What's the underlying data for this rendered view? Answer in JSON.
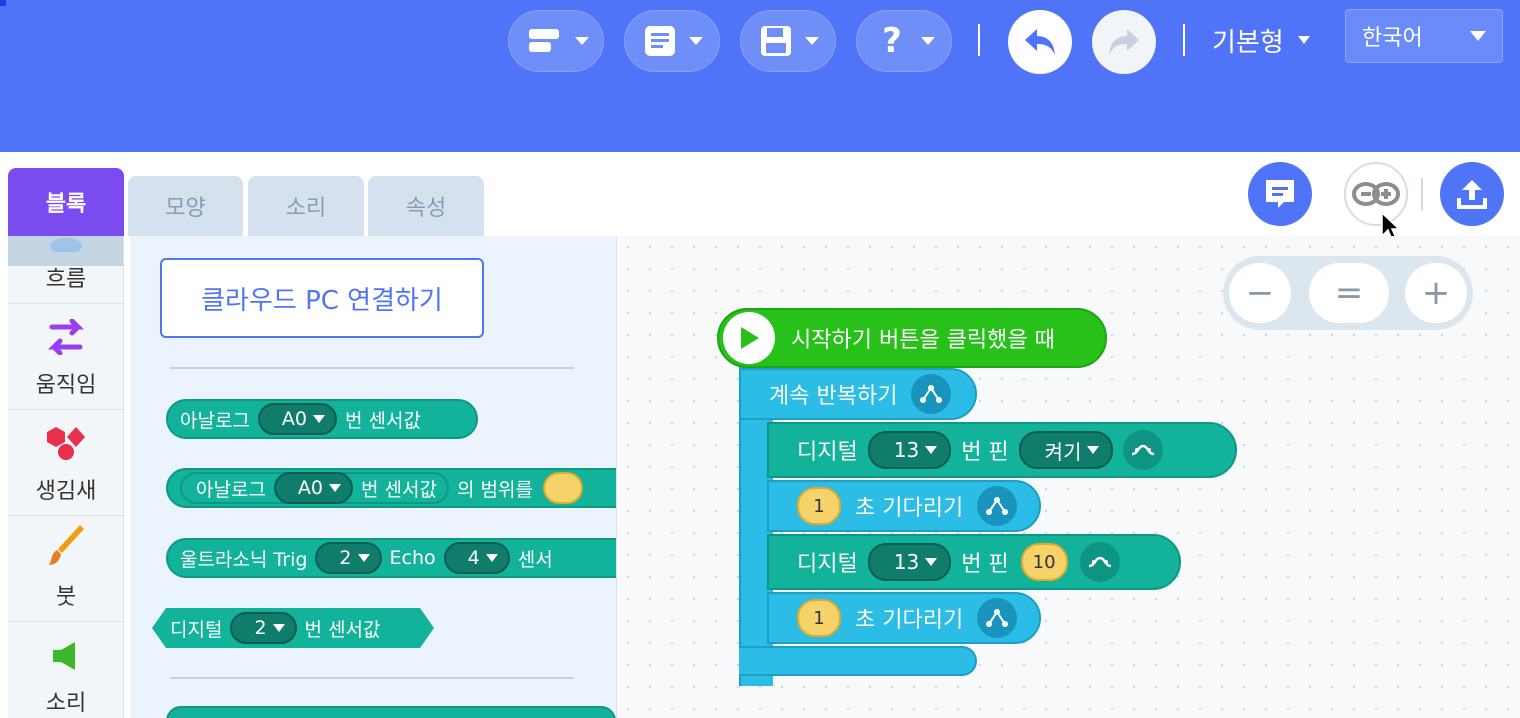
{
  "colors": {
    "header": "#4f74f7",
    "tab_active": "#7a4cf0",
    "hardware_block": "#12b29b",
    "flow_block": "#2cbde6",
    "start_block": "#27c11a",
    "number_oval": "#f6d26b"
  },
  "header": {
    "menu_buttons": [
      {
        "icon": "blocks-icon"
      },
      {
        "icon": "document-icon"
      },
      {
        "icon": "save-icon"
      },
      {
        "icon": "help-icon"
      }
    ],
    "undo_icon": "undo-icon",
    "redo_icon": "redo-icon",
    "mode_label": "기본형",
    "language": "한국어"
  },
  "tabs": [
    {
      "label": "블록",
      "active": true
    },
    {
      "label": "모양",
      "active": false
    },
    {
      "label": "소리",
      "active": false
    },
    {
      "label": "속성",
      "active": false
    }
  ],
  "side_buttons": [
    "chat-icon",
    "arduino-icon",
    "upload-icon"
  ],
  "categories": [
    {
      "label": "흐름",
      "icon": "flow-icon"
    },
    {
      "label": "움직임",
      "icon": "move-arrows-icon"
    },
    {
      "label": "생김새",
      "icon": "shapes-icon"
    },
    {
      "label": "붓",
      "icon": "brush-icon"
    },
    {
      "label": "소리",
      "icon": "speaker-icon"
    }
  ],
  "palette": {
    "cloud_button": "클라우드 PC 연결하기",
    "blocks": [
      {
        "pre": "아날로그",
        "drop": "A0",
        "post": "번 센서값"
      },
      {
        "pre": "아날로그",
        "drop": "A0",
        "post": "번 센서값",
        "tail": "의 범위를"
      },
      {
        "pre": "울트라소닉 Trig",
        "drop": "2",
        "mid": "Echo",
        "drop2": "4",
        "tail": "센서"
      },
      {
        "pre": "디지털",
        "drop": "2",
        "post": "번 센서값"
      }
    ]
  },
  "zoom": {
    "minus": "−",
    "reset": "=",
    "plus": "+"
  },
  "script": {
    "start": "시작하기 버튼을 클릭했을 때",
    "loop": "계속 반복하기",
    "digital1": {
      "label": "디지털",
      "pin": "13",
      "pin_label": "번 핀",
      "state": "켜기"
    },
    "wait1": {
      "seconds": "1",
      "label": "초 기다리기"
    },
    "digital2": {
      "label": "디지털",
      "pin": "13",
      "pin_label": "번 핀",
      "value": "10"
    },
    "wait2": {
      "seconds": "1",
      "label": "초 기다리기"
    }
  }
}
